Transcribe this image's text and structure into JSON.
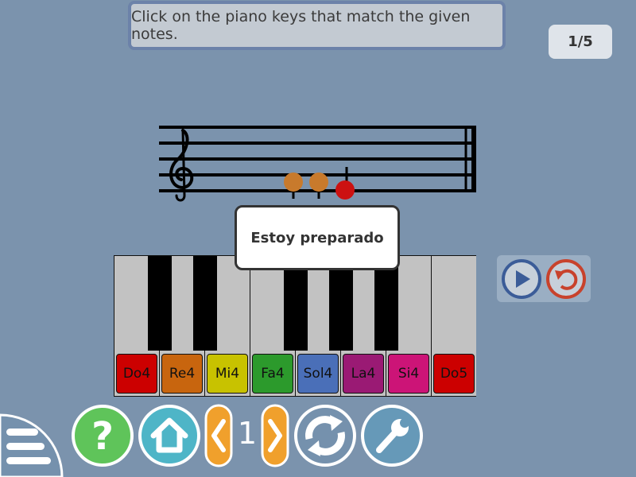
{
  "instruction": "Click on the piano keys that match the given notes.",
  "progress": "1/5",
  "popup": {
    "label": "Estoy preparado"
  },
  "staff": {
    "clef": "treble-clef-icon",
    "notes": [
      {
        "color": "#c87a2c"
      },
      {
        "color": "#c87a2c"
      },
      {
        "color": "#cc1111"
      }
    ]
  },
  "piano": {
    "white_keys": [
      {
        "label": "Do4",
        "color": "#cc0000"
      },
      {
        "label": "Re4",
        "color": "#c8650e"
      },
      {
        "label": "Mi4",
        "color": "#c8c200"
      },
      {
        "label": "Fa4",
        "color": "#2c9a2c"
      },
      {
        "label": "Sol4",
        "color": "#4a6fb8"
      },
      {
        "label": "La4",
        "color": "#9a1a74"
      },
      {
        "label": "Si4",
        "color": "#cc1477"
      },
      {
        "label": "Do5",
        "color": "#cc0000"
      }
    ]
  },
  "controls": {
    "play": "play-icon",
    "replay": "undo-icon"
  },
  "bottom_bar": {
    "menu": "menu-icon",
    "help": "?",
    "home": "home-icon",
    "level": "1",
    "reload": "reload-icon",
    "settings": "wrench-icon"
  },
  "colors": {
    "background": "#7b93ad",
    "help": "#5fc45a",
    "home": "#4eb5c7",
    "level": "#f0a02c",
    "reload": "#7591ad",
    "settings": "#6699b8"
  }
}
